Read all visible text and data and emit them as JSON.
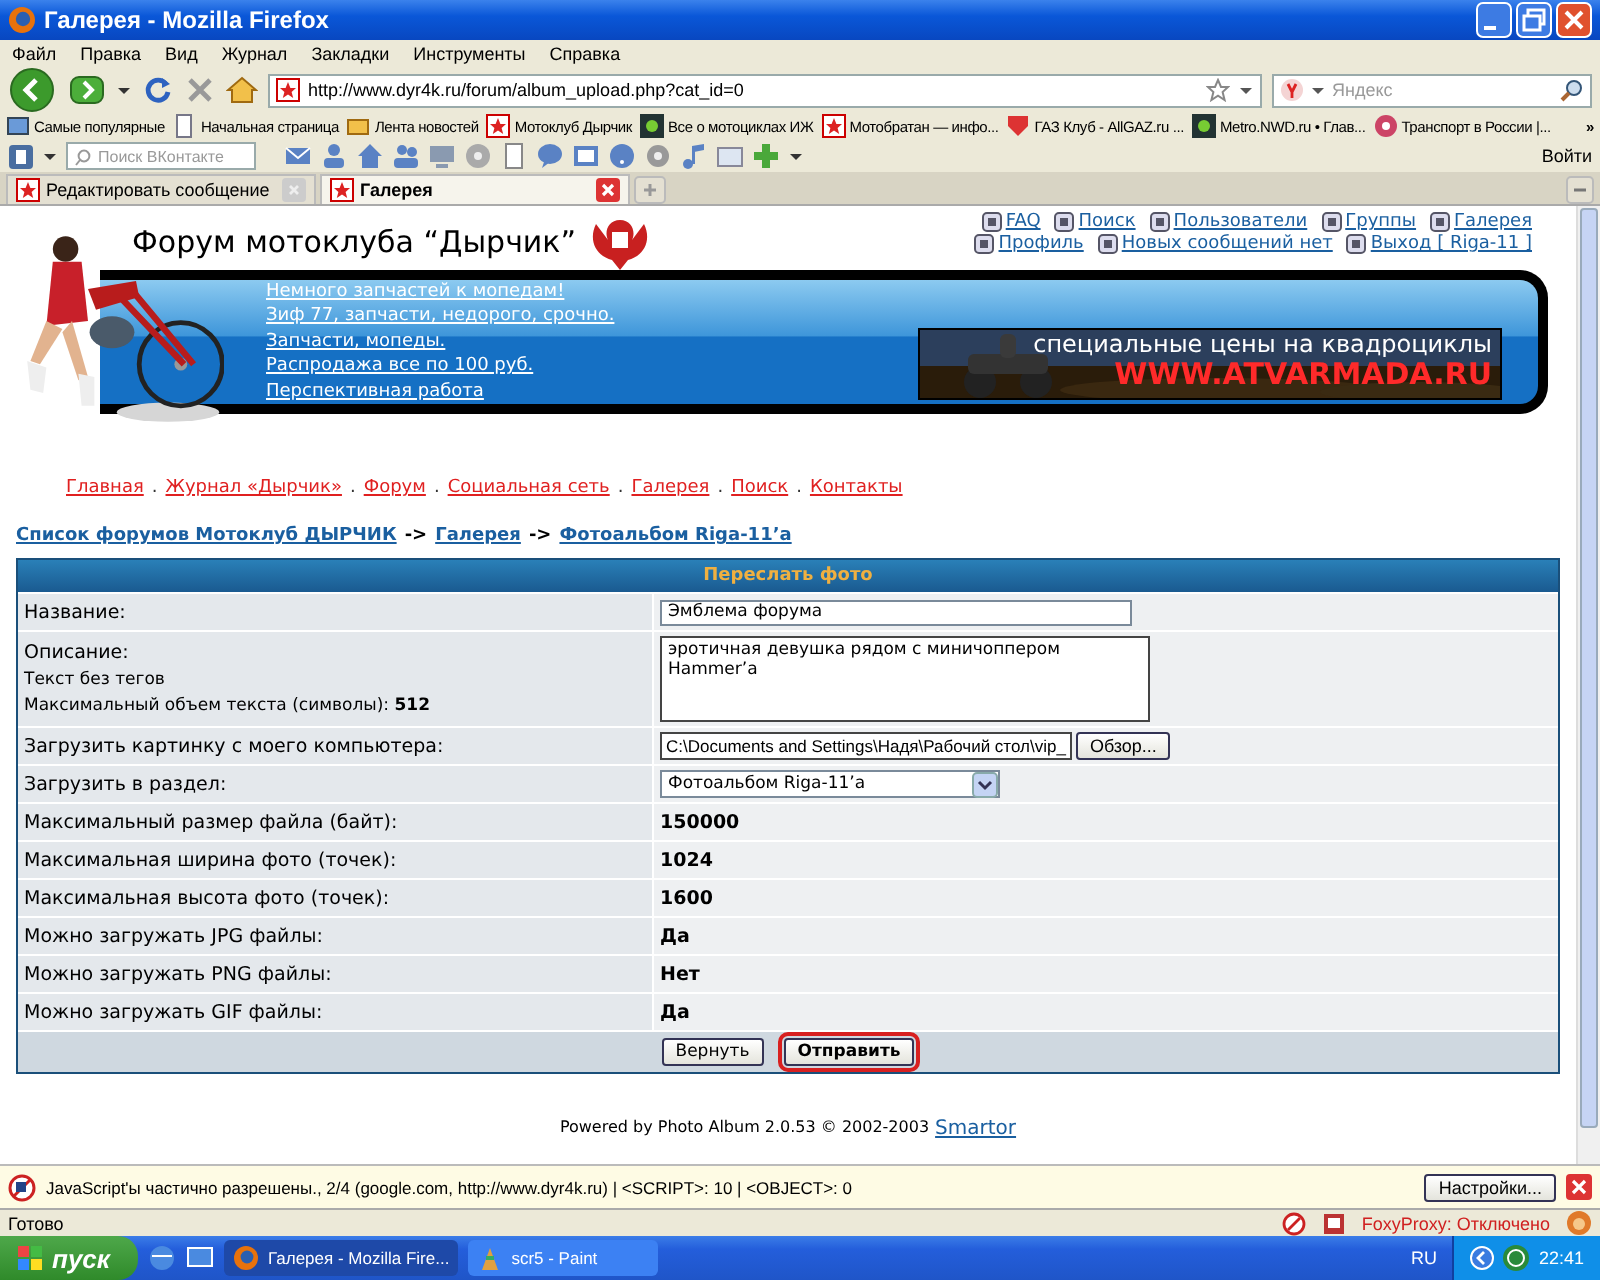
{
  "window": {
    "title": "Галерея - Mozilla Firefox"
  },
  "menu": [
    "Файл",
    "Правка",
    "Вид",
    "Журнал",
    "Закладки",
    "Инструменты",
    "Справка"
  ],
  "address": {
    "url": "http://www.dyr4k.ru/forum/album_upload.php?cat_id=0"
  },
  "web_search": {
    "placeholder": "Яндекс"
  },
  "bookmarks": [
    {
      "label": "Самые популярные",
      "kind": "folder"
    },
    {
      "label": "Начальная страница",
      "kind": "page"
    },
    {
      "label": "Лента новостей",
      "kind": "feed"
    },
    {
      "label": "Мотоклуб Дырчик",
      "kind": "star"
    },
    {
      "label": "Все о мотоциклах ИЖ",
      "kind": "logo"
    },
    {
      "label": "Мотобратан — инфо...",
      "kind": "star"
    },
    {
      "label": "ГАЗ Клуб - AllGAZ.ru ...",
      "kind": "shield"
    },
    {
      "label": "Metro.NWD.ru • Глав...",
      "kind": "logo"
    },
    {
      "label": "Транспорт в России |...",
      "kind": "circle"
    },
    {
      "label": "»",
      "kind": "more"
    }
  ],
  "vk_toolbar": {
    "placeholder": "Поиск ВКонтакте",
    "login": "Войти"
  },
  "tabs": [
    {
      "label": "Редактировать сообщение",
      "selected": false
    },
    {
      "label": "Галерея",
      "selected": true
    }
  ],
  "page": {
    "title": "Форум мотоклуба “Дырчик”",
    "header_links": [
      [
        "FAQ",
        "Поиск",
        "Пользователи",
        "Группы",
        "Галерея"
      ],
      [
        "Профиль",
        "Новых сообщений нет",
        "Выход [ Riga-11 ]"
      ]
    ],
    "news": [
      "Немного запчастей к мопедам!",
      "Зиф 77, запчасти, недорого, срочно.",
      "Запчасти, мопеды.",
      "Распродажа все по 100 руб.",
      "Перспективная работа"
    ],
    "banner": {
      "line1": "специальные цены на квадроциклы",
      "line2": "WWW.ATVARMADA.RU"
    },
    "nav": [
      {
        "kind": "link",
        "text": "Главная"
      },
      {
        "kind": "sep",
        "text": "."
      },
      {
        "kind": "link",
        "text": "Журнал «Дырчик»"
      },
      {
        "kind": "sep",
        "text": "."
      },
      {
        "kind": "link",
        "text": "Форум"
      },
      {
        "kind": "sep",
        "text": "."
      },
      {
        "kind": "link",
        "text": "Социальная сеть"
      },
      {
        "kind": "sep",
        "text": "."
      },
      {
        "kind": "link",
        "text": "Галерея"
      },
      {
        "kind": "sep",
        "text": "."
      },
      {
        "kind": "link",
        "text": "Поиск"
      },
      {
        "kind": "sep",
        "text": "."
      },
      {
        "kind": "link",
        "text": "Контакты"
      }
    ],
    "breadcrumb": [
      {
        "kind": "link",
        "text": "Список форумов Мотоклуб ДЫРЧИК"
      },
      {
        "kind": "sep",
        "text": "->"
      },
      {
        "kind": "link",
        "text": "Галерея"
      },
      {
        "kind": "sep",
        "text": "->"
      },
      {
        "kind": "link",
        "text": "Фотоальбом Riga-11’a"
      }
    ],
    "form": {
      "title": "Переслать фото",
      "rows": [
        {
          "kind": "text",
          "label": "Название:",
          "value": "Эмблема форума"
        },
        {
          "kind": "textarea",
          "label": "Описание:",
          "notes": [
            "Текст без тегов",
            "Максимальный объем текста (символы): **512**"
          ],
          "value": "эротичная девушка рядом с миничоппером Hammer’а"
        },
        {
          "kind": "file",
          "label": "Загрузить картинку с моего компьютера:",
          "value": "C:\\Documents and Settings\\Надя\\Рабочий стол\\vip_",
          "button": "Обзор..."
        },
        {
          "kind": "select",
          "label": "Загрузить в раздел:",
          "value": "Фотоальбом Riga-11’a"
        },
        {
          "kind": "info",
          "label": "Максимальный размер файла (байт):",
          "value": "150000"
        },
        {
          "kind": "info",
          "label": "Максимальная ширина фото (точек):",
          "value": "1024"
        },
        {
          "kind": "info",
          "label": "Максимальная высота фото (точек):",
          "value": "1600"
        },
        {
          "kind": "info",
          "label": "Можно загружать JPG файлы:",
          "value": "Да"
        },
        {
          "kind": "info",
          "label": "Можно загружать PNG файлы:",
          "value": "Нет"
        },
        {
          "kind": "info",
          "label": "Можно загружать GIF файлы:",
          "value": "Да"
        }
      ],
      "buttons": [
        {
          "label": "Вернуть",
          "selected": false
        },
        {
          "label": "Отправить",
          "selected": true
        }
      ]
    },
    "footer": {
      "text": "Powered by Photo Album 2.0.53 © 2002-2003",
      "link": "Smartor"
    }
  },
  "noscript": {
    "message": "JavaScript'ы частично разрешены., 2/4 (google.com, http://www.dyr4k.ru) | <SCRIPT>: 10 | <OBJECT>: 0",
    "button": "Настройки..."
  },
  "status_bar": {
    "text": "Готово",
    "proxy": "FoxyProxy: Отключено"
  },
  "taskbar": {
    "start": "пуск",
    "items": [
      {
        "label": "Галерея - Mozilla Fire...",
        "selected": true
      },
      {
        "label": "scr5 - Paint",
        "selected": false
      }
    ],
    "lang": "RU",
    "time": "22:41"
  }
}
